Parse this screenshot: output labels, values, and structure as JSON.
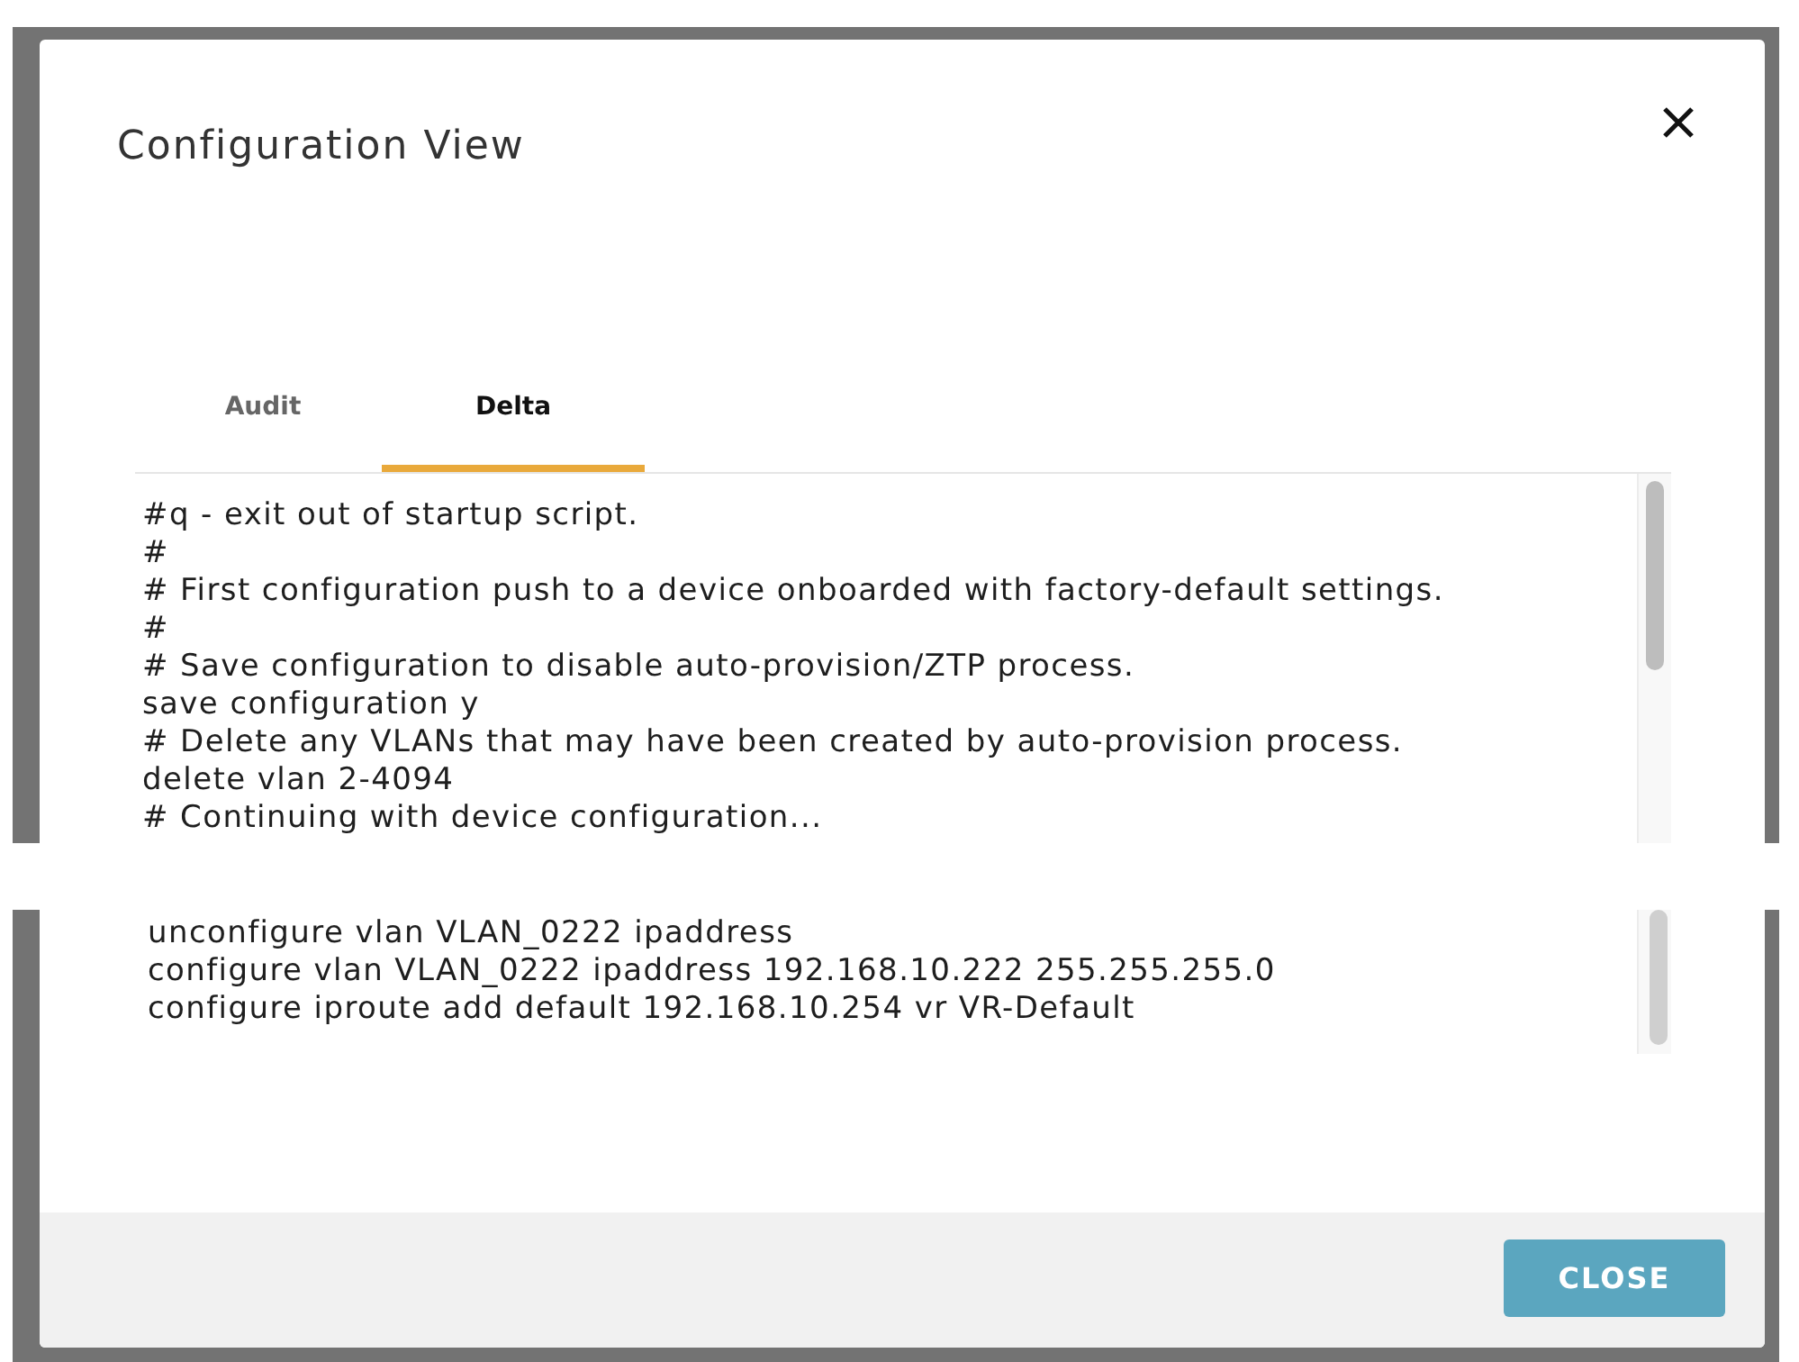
{
  "dialog": {
    "title": "Configuration View"
  },
  "tabs": [
    {
      "label": "Audit",
      "selected": false
    },
    {
      "label": "Delta",
      "selected": true
    }
  ],
  "config_view": {
    "fragments": [
      {
        "lines": [
          "#q - exit out of startup script.",
          "#",
          "# First configuration push to a device onboarded with factory-default settings.",
          "#",
          "# Save configuration to disable auto-provision/ZTP process.",
          "save configuration y",
          "# Delete any VLANs that may have been created by auto-provision process.",
          "delete vlan 2-4094",
          "# Continuing with device configuration..."
        ]
      },
      {
        "lines": [
          "unconfigure vlan VLAN_0222 ipaddress",
          "configure vlan VLAN_0222 ipaddress 192.168.10.222 255.255.255.0",
          "configure iproute add default 192.168.10.254 vr VR-Default"
        ]
      }
    ]
  },
  "footer": {
    "buttons": [
      {
        "label": "CLOSE"
      }
    ]
  }
}
